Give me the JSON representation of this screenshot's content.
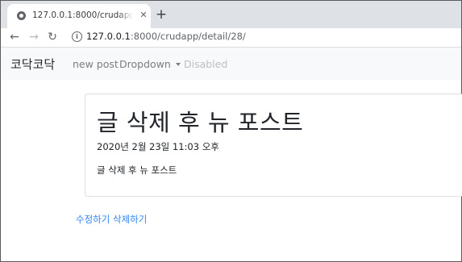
{
  "browser": {
    "tab_title": "127.0.0.1:8000/crudapp/detail/28/",
    "tab_close": "✕",
    "new_tab": "+",
    "back": "←",
    "forward": "→",
    "reload": "↻",
    "info": "i",
    "url_host": "127.0.0.1",
    "url_path": ":8000/crudapp/detail/28/"
  },
  "navbar": {
    "brand": "코닥코닥",
    "links": [
      "new post",
      "Dropdown",
      "Disabled"
    ]
  },
  "post": {
    "title": "글 삭제 후 뉴 포스트",
    "date": "2020년 2월 23일 11:03 오후",
    "body": "글 삭제 후 뉴 포스트"
  },
  "actions": {
    "edit": "수정하기",
    "delete": "삭제하기"
  },
  "colors": {
    "link": "#2f86f6",
    "navbar_bg": "#f8f9fa",
    "tabstrip_bg": "#dee1e6"
  }
}
